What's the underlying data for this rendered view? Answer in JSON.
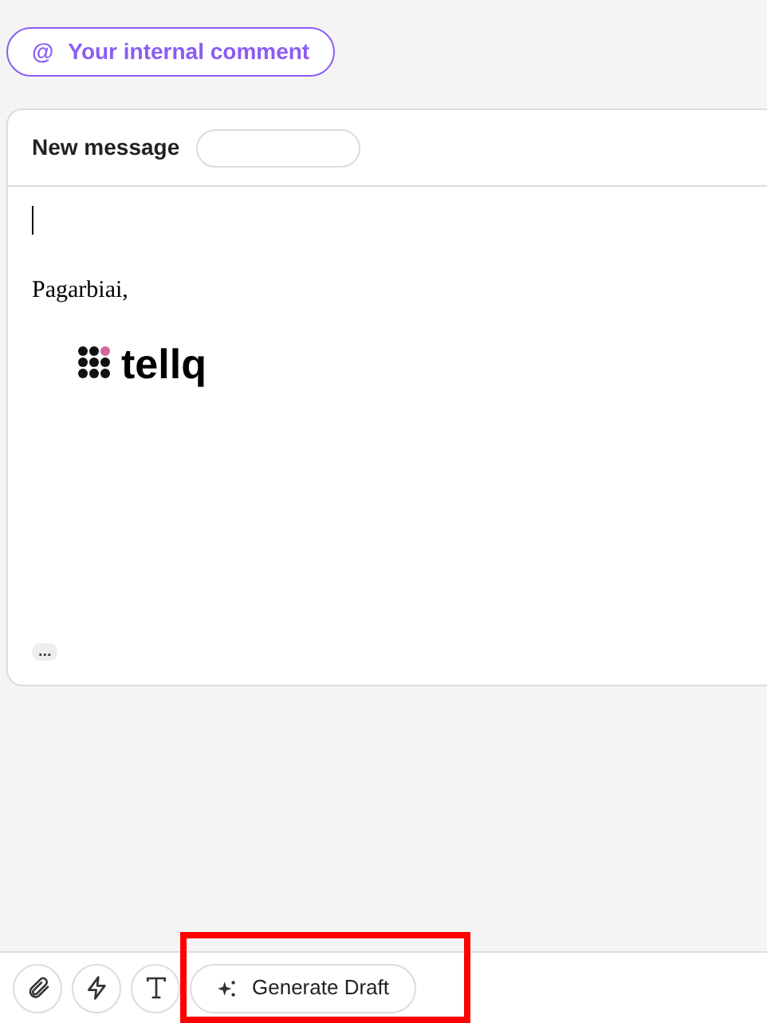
{
  "internal_comment_button": {
    "icon": "@",
    "label": "Your internal comment"
  },
  "composer": {
    "title": "New message",
    "body_lines": [
      "Pagarbiai,"
    ],
    "logo_text": "tellq",
    "more_chip": "..."
  },
  "toolbar": {
    "buttons": [
      {
        "kind": "attach"
      },
      {
        "kind": "bolt"
      },
      {
        "kind": "text"
      }
    ],
    "generate_button": {
      "label": "Generate Draft",
      "highlighted": true
    }
  }
}
